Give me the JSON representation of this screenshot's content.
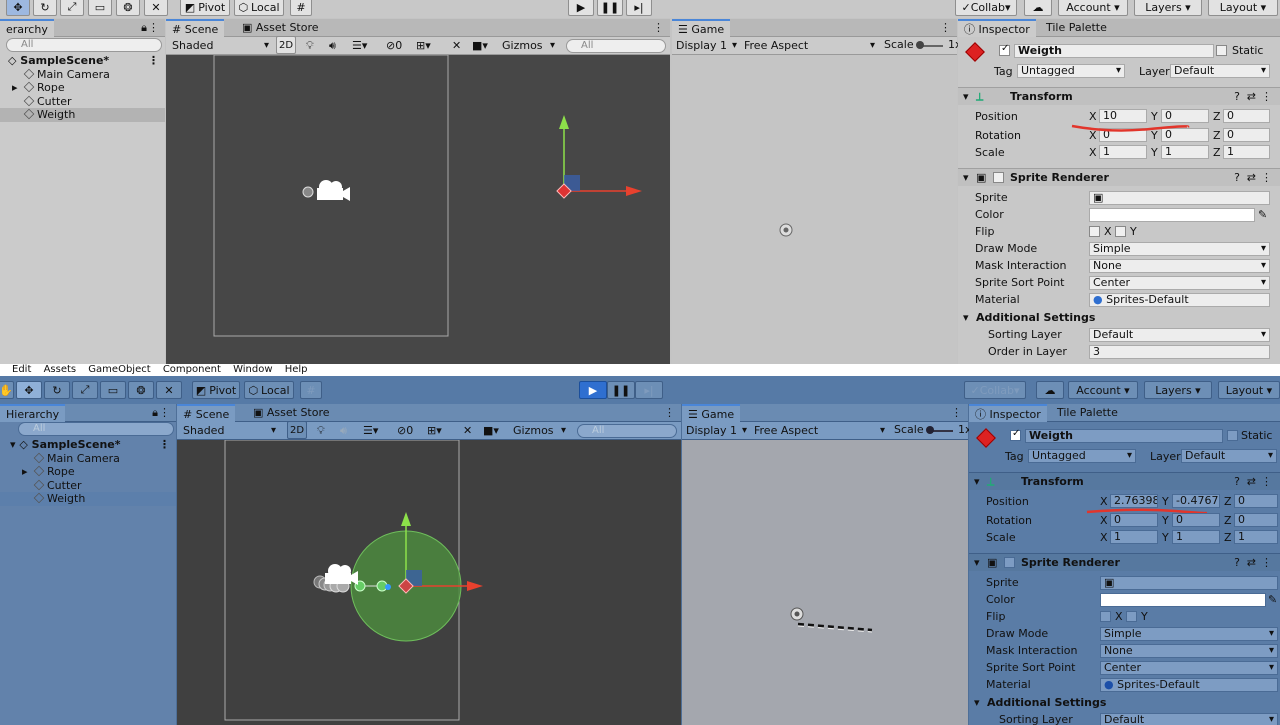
{
  "top": {
    "toolbar": {
      "pivot": "Pivot",
      "local": "Local",
      "collab": "Collab",
      "account": "Account",
      "layers": "Layers",
      "layout": "Layout"
    },
    "hierarchy": {
      "tab": "erarchy",
      "search": "All",
      "scene": "SampleScene*",
      "items": [
        "Main Camera",
        "Rope",
        "Cutter",
        "Weigth"
      ],
      "selected": "Weigth"
    },
    "scene": {
      "tab": "Scene",
      "tab2": "Asset Store",
      "shading": "Shaded",
      "mode2d": "2D",
      "hidden_count": "0",
      "gizmos": "Gizmos",
      "search": "All"
    },
    "game": {
      "tab": "Game",
      "display": "Display 1",
      "aspect": "Free Aspect",
      "scale_label": "Scale",
      "scale_value": "1x"
    },
    "inspector": {
      "tab": "Inspector",
      "tab2": "Tile Palette",
      "name": "Weigth",
      "static": "Static",
      "tag_label": "Tag",
      "tag": "Untagged",
      "layer_label": "Layer",
      "layer": "Default",
      "transform": {
        "title": "Transform",
        "position_label": "Position",
        "rotation_label": "Rotation",
        "scale_label": "Scale",
        "position": {
          "x": "10",
          "y": "0",
          "z": "0"
        },
        "rotation": {
          "x": "0",
          "y": "0",
          "z": "0"
        },
        "scale": {
          "x": "1",
          "y": "1",
          "z": "1"
        }
      },
      "sprite_renderer": {
        "title": "Sprite Renderer",
        "sprite": "Sprite",
        "color": "Color",
        "flip": "Flip",
        "flip_x": "X",
        "flip_y": "Y",
        "draw_mode_label": "Draw Mode",
        "draw_mode": "Simple",
        "mask_label": "Mask Interaction",
        "mask": "None",
        "sort_point_label": "Sprite Sort Point",
        "sort_point": "Center",
        "material_label": "Material",
        "material": "Sprites-Default",
        "additional": "Additional Settings",
        "sorting_layer_label": "Sorting Layer",
        "sorting_layer": "Default",
        "order_label": "Order in Layer",
        "order": "3"
      }
    }
  },
  "menubar": [
    "Edit",
    "Assets",
    "GameObject",
    "Component",
    "Window",
    "Help"
  ],
  "bottom": {
    "toolbar": {
      "pivot": "Pivot",
      "local": "Local",
      "collab": "Collab",
      "account": "Account",
      "layers": "Layers",
      "layout": "Layout"
    },
    "hierarchy": {
      "tab": "Hierarchy",
      "search": "All",
      "scene": "SampleScene*",
      "items": [
        "Main Camera",
        "Rope",
        "Cutter",
        "Weigth"
      ],
      "selected": "Weigth"
    },
    "scene": {
      "tab": "Scene",
      "tab2": "Asset Store",
      "shading": "Shaded",
      "mode2d": "2D",
      "hidden_count": "0",
      "gizmos": "Gizmos",
      "search": "All"
    },
    "game": {
      "tab": "Game",
      "display": "Display 1",
      "aspect": "Free Aspect",
      "scale_label": "Scale",
      "scale_value": "1x"
    },
    "inspector": {
      "tab": "Inspector",
      "tab2": "Tile Palette",
      "name": "Weigth",
      "static": "Static",
      "tag_label": "Tag",
      "tag": "Untagged",
      "layer_label": "Layer",
      "layer": "Default",
      "transform": {
        "title": "Transform",
        "position_label": "Position",
        "rotation_label": "Rotation",
        "scale_label": "Scale",
        "position": {
          "x": "2.763982",
          "y": "-0.47679",
          "z": "0"
        },
        "rotation": {
          "x": "0",
          "y": "0",
          "z": "0"
        },
        "scale": {
          "x": "1",
          "y": "1",
          "z": "1"
        }
      },
      "sprite_renderer": {
        "title": "Sprite Renderer",
        "sprite": "Sprite",
        "color": "Color",
        "flip": "Flip",
        "flip_x": "X",
        "flip_y": "Y",
        "draw_mode_label": "Draw Mode",
        "draw_mode": "Simple",
        "mask_label": "Mask Interaction",
        "mask": "None",
        "sort_point_label": "Sprite Sort Point",
        "sort_point": "Center",
        "material_label": "Material",
        "material": "Sprites-Default",
        "additional": "Additional Settings",
        "sorting_layer_label": "Sorting Layer",
        "sorting_layer": "Default"
      }
    }
  },
  "colors": {
    "play_active": "#2f6fd0",
    "annotation": "#e2352b",
    "selection_blue": "#4a86d8"
  }
}
